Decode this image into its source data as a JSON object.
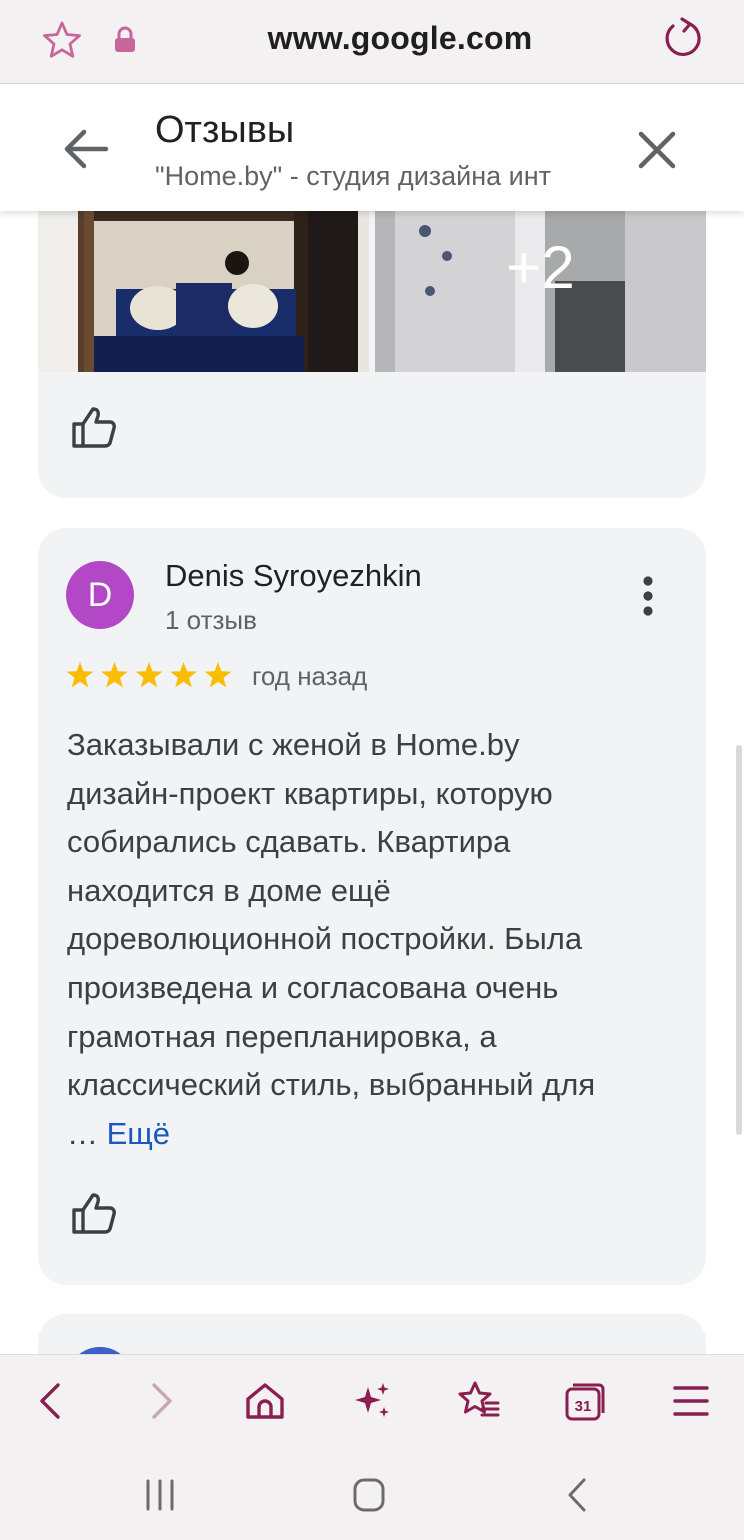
{
  "browser": {
    "url": "www.google.com"
  },
  "header": {
    "title": "Отзывы",
    "subtitle": "\"Home.by\" - студия дизайна инт"
  },
  "gallery": {
    "more_photos": "+2"
  },
  "review": {
    "avatar_letter": "D",
    "author": "Denis Syroyezhkin",
    "review_count": "1 отзыв",
    "rating": 5,
    "time": "год назад",
    "text_lines": [
      "Заказывали с женой в Home.by",
      "дизайн-проект квартиры, которую",
      "собирались сдавать. Квартира",
      "находится в доме ещё",
      "дореволюционной постройки. Была",
      "произведена и согласована очень",
      "грамотная перепланировка, а",
      "классический стиль, выбранный для"
    ],
    "ellipsis": "…",
    "more_link": "Ещё"
  },
  "colors": {
    "accent": "#8a1f4f",
    "card_bg": "#f1f3f4",
    "star": "#fbbc04",
    "link": "#1a57c2",
    "avatar": "#b348c7"
  },
  "icons": {
    "url_bar": [
      "star-outline-icon",
      "lock-icon",
      "reload-icon"
    ],
    "header": [
      "back-arrow-icon",
      "close-icon"
    ],
    "toolbar": [
      "back-icon",
      "forward-icon",
      "home-icon",
      "sparkle-icon",
      "bookmarks-icon",
      "tabs-icon",
      "menu-icon"
    ],
    "system_nav": [
      "recent-apps-icon",
      "home-nav-icon",
      "back-nav-icon"
    ]
  }
}
